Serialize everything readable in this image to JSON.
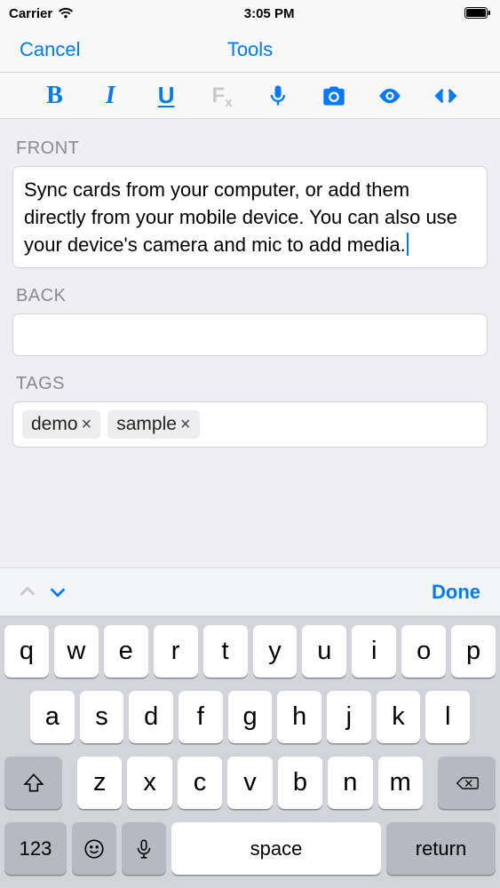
{
  "status": {
    "carrier": "Carrier",
    "time": "3:05 PM"
  },
  "nav": {
    "cancel": "Cancel",
    "title": "Tools"
  },
  "toolbar": {
    "bold": "B",
    "italic": "I",
    "underline": "U",
    "fx": "Fx"
  },
  "fields": {
    "front_label": "FRONT",
    "front_value": "Sync cards from your computer, or add them directly from your mobile device. You can also use your device's camera and mic to add media.",
    "back_label": "BACK",
    "back_value": "",
    "tags_label": "TAGS",
    "tags": [
      "demo",
      "sample"
    ]
  },
  "kbd_accessory": {
    "done": "Done"
  },
  "keyboard": {
    "row1": [
      "q",
      "w",
      "e",
      "r",
      "t",
      "y",
      "u",
      "i",
      "o",
      "p"
    ],
    "row2": [
      "a",
      "s",
      "d",
      "f",
      "g",
      "h",
      "j",
      "k",
      "l"
    ],
    "row3": [
      "z",
      "x",
      "c",
      "v",
      "b",
      "n",
      "m"
    ],
    "num": "123",
    "space": "space",
    "return": "return"
  }
}
